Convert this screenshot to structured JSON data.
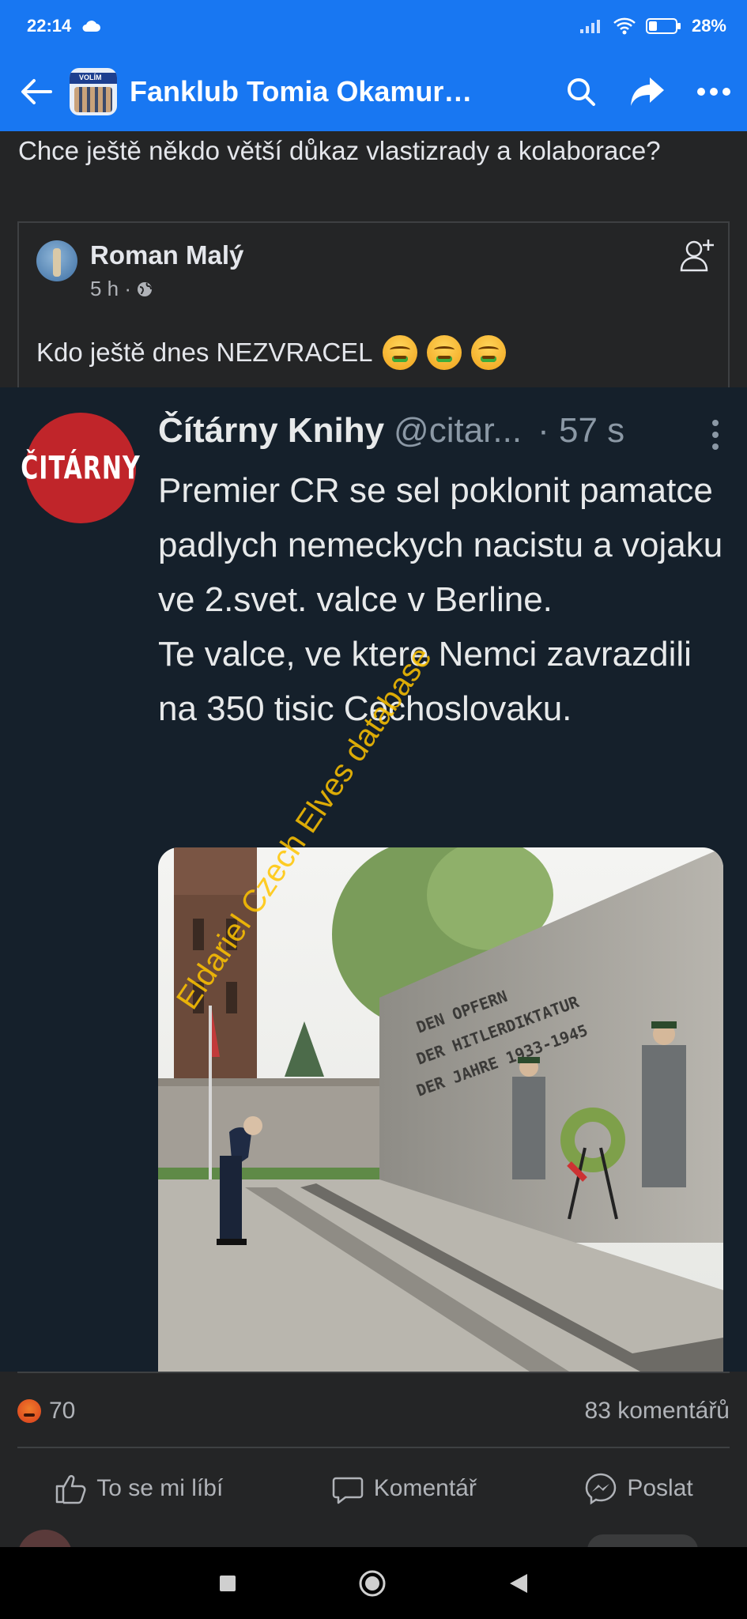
{
  "status_bar": {
    "time": "22:14",
    "battery": "28%"
  },
  "app_bar": {
    "title": "Fanklub Tomia Okamur…",
    "group_avatar_text": "VOLÍM"
  },
  "post": {
    "text": "Chce ještě někdo větší důkaz vlastizrady a kolaborace?"
  },
  "shared_post": {
    "author": "Roman Malý",
    "time": "5 h ·",
    "text": "Kdo ještě dnes NEZVRACEL"
  },
  "tweet": {
    "avatar_text": "ČITÁRNY",
    "name": "Čítárny Knihy",
    "handle": "@citar...",
    "time": "· 57 s",
    "lines": [
      "Premier CR se sel poklonit pamatce padlych nemeckych nacistu a vojaku ve 2.svet. valce v Berline.",
      "Te valce, ve ktere Nemci zavrazdili na 350 tisic Cechoslovaku."
    ],
    "photo_inscription": [
      "DEN OPFERN",
      "DER HITLERDIKTATUR",
      "DER JAHRE 1933-1945"
    ]
  },
  "watermark": "Eldariel Czech Elves database",
  "engagement": {
    "reaction_count": "70",
    "comments": "83 komentářů"
  },
  "actions": {
    "like": "To se mi líbí",
    "comment": "Komentář",
    "share": "Poslat"
  }
}
